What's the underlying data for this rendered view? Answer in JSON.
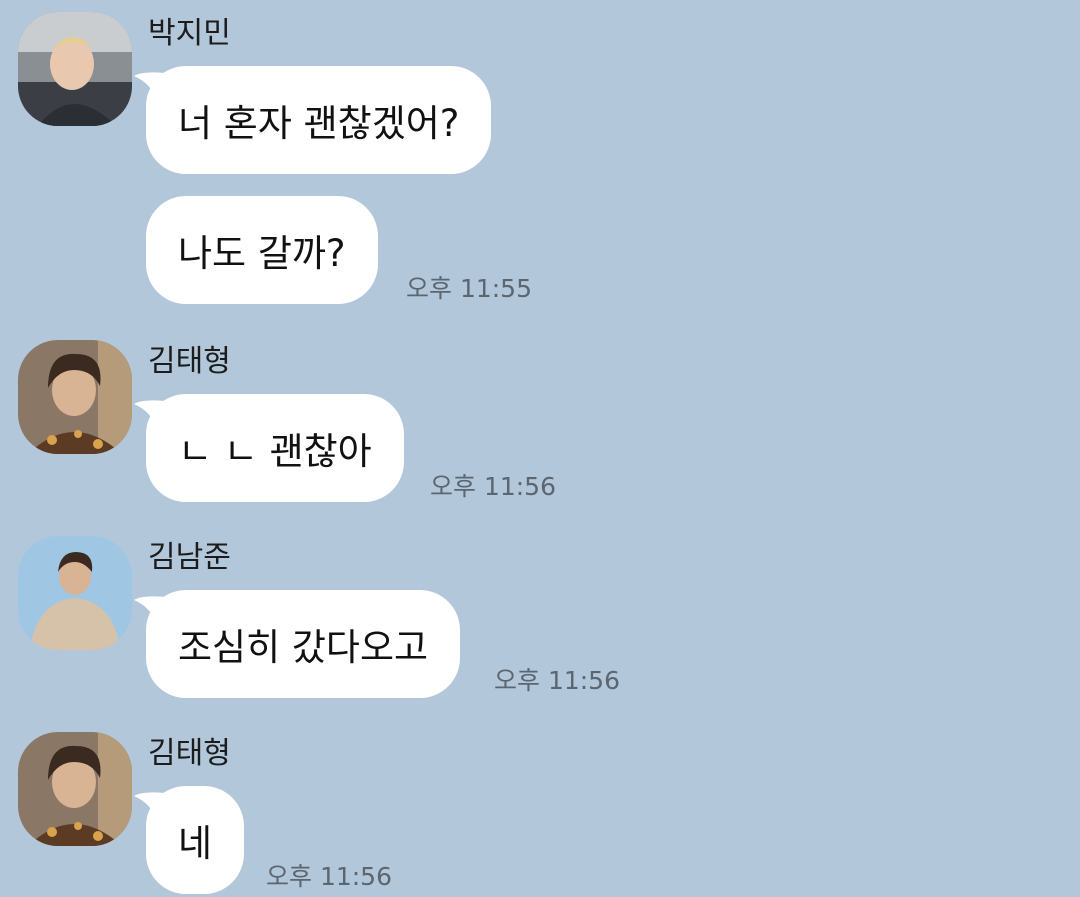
{
  "messages": [
    {
      "sender": "박지민",
      "avatar_icon": "profile-photo-jimin",
      "bubbles": [
        "너 혼자 괜찮겠어?",
        "나도 갈까?"
      ],
      "time": "오후 11:55"
    },
    {
      "sender": "김태형",
      "avatar_icon": "profile-photo-taehyung",
      "bubbles": [
        "ㄴ ㄴ 괜찮아"
      ],
      "time": "오후 11:56"
    },
    {
      "sender": "김남준",
      "avatar_icon": "profile-photo-namjoon",
      "bubbles": [
        "조심히 갔다오고"
      ],
      "time": "오후 11:56"
    },
    {
      "sender": "김태형",
      "avatar_icon": "profile-photo-taehyung",
      "bubbles": [
        "네"
      ],
      "time": "오후 11:56"
    }
  ],
  "colors": {
    "background": "#b2c7da",
    "bubble": "#ffffff",
    "time_text": "#5b6670"
  }
}
